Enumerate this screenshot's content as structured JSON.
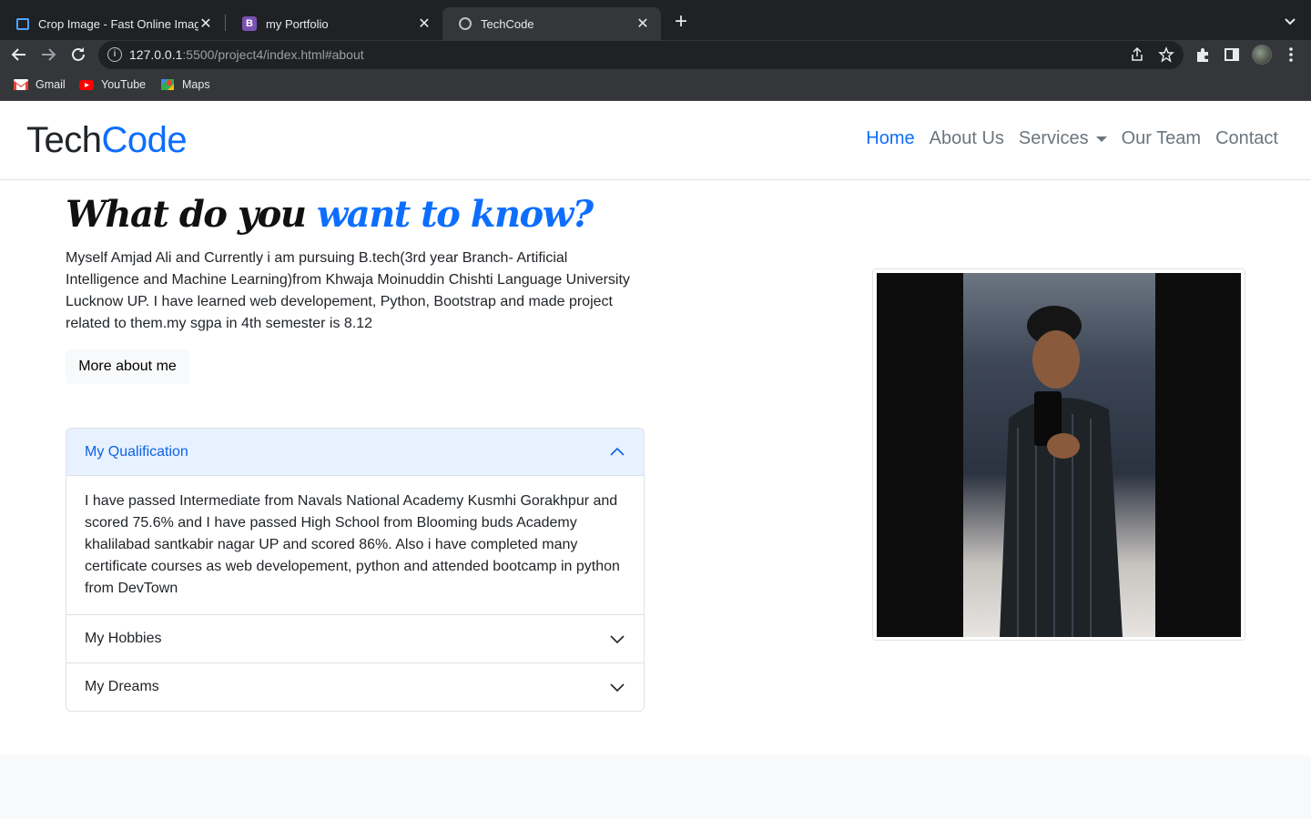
{
  "browser": {
    "tabs": [
      {
        "title": "Crop Image - Fast Online Image Cropper",
        "favicon": "crop-icon",
        "active": false
      },
      {
        "title": "my Portfolio",
        "favicon": "bootstrap-icon",
        "active": false
      },
      {
        "title": "TechCode",
        "favicon": "globe-icon",
        "active": true
      }
    ],
    "tab_close": "✕",
    "new_tab": "+",
    "address": {
      "host": "127.0.0.1",
      "rest": ":5500/project4/index.html#about",
      "info": "i"
    },
    "bookmarks": [
      {
        "label": "Gmail",
        "icon": "gmail-icon"
      },
      {
        "label": "YouTube",
        "icon": "youtube-icon"
      },
      {
        "label": "Maps",
        "icon": "maps-icon"
      }
    ]
  },
  "navbar": {
    "brand_part1": "Tech",
    "brand_part2": "Code",
    "links": {
      "home": "Home",
      "about": "About Us",
      "services": "Services",
      "team": "Our Team",
      "contact": "Contact"
    }
  },
  "about": {
    "heading_part1": "What do you",
    "heading_part2": "want to know?",
    "text": "Myself Amjad Ali and Currently i am pursuing B.tech(3rd year Branch- Artificial Intelligence and Machine Learning)from Khwaja Moinuddin Chishti Language University Lucknow UP. I have learned web developement, Python, Bootstrap and made project related to them.my sgpa in 4th semester is 8.12",
    "more_button": "More about me"
  },
  "accordion": {
    "qualification": {
      "title": "My Qualification",
      "body": "I have passed Intermediate from Navals National Academy Kusmhi Gorakhpur and scored 75.6% and I have passed High School from Blooming buds Academy khalilabad santkabir nagar UP and scored 86%. Also i have completed many certificate courses as web developement, python and attended bootcamp in python from DevTown"
    },
    "hobbies": {
      "title": "My Hobbies"
    },
    "dreams": {
      "title": "My Dreams"
    }
  },
  "colors": {
    "accent": "#0d6efd",
    "nav_text": "#6c757d",
    "chrome_dark": "#202124",
    "chrome_toolbar": "#35363a",
    "accordion_open_bg": "#e7f1ff"
  }
}
